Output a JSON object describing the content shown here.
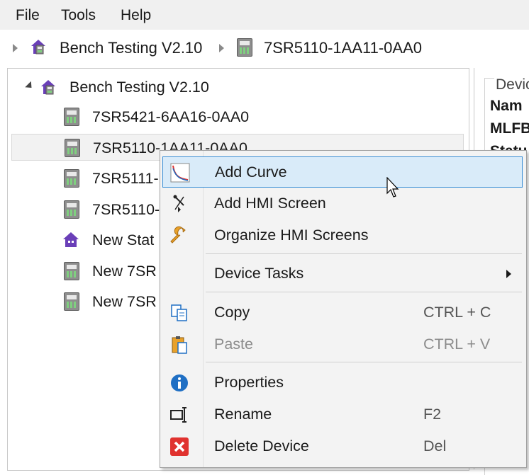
{
  "menubar": {
    "items": [
      "File",
      "Tools",
      "Help"
    ]
  },
  "breadcrumb": {
    "items": [
      "Bench Testing V2.10",
      "7SR5110-1AA11-0AA0"
    ]
  },
  "tree": {
    "root": "Bench Testing V2.10",
    "children": [
      "7SR5421-6AA16-0AA0",
      "7SR5110-1AA11-0AA0",
      "7SR5111-",
      "7SR5110-",
      "New Stat",
      "New 7SR",
      "New 7SR"
    ]
  },
  "right_panel": {
    "group_label": "Devic",
    "rows": [
      "Nam",
      "MLFB",
      "Statu"
    ]
  },
  "context_menu": {
    "items": [
      {
        "label": "Add Curve",
        "icon": "curve-icon"
      },
      {
        "label": "Add HMI Screen",
        "icon": "hmi-screen-icon"
      },
      {
        "label": "Organize HMI Screens",
        "icon": "wrench-icon"
      },
      {
        "label": "Device Tasks",
        "icon": ""
      },
      {
        "label": "Copy",
        "shortcut": "CTRL + C",
        "icon": "copy-icon"
      },
      {
        "label": "Paste",
        "shortcut": "CTRL + V",
        "icon": "paste-icon"
      },
      {
        "label": "Properties",
        "icon": "info-icon"
      },
      {
        "label": "Rename",
        "shortcut": "F2",
        "icon": "rename-icon"
      },
      {
        "label": "Delete Device",
        "shortcut": "Del",
        "icon": "delete-icon"
      }
    ]
  },
  "colors": {
    "highlight_bg": "#d9ebf9",
    "highlight_border": "#3a8fd6",
    "menubar_bg": "#f0f0f0",
    "delete_red": "#e0322f",
    "info_blue": "#1f6fc4",
    "wrench_orange": "#e8a12a"
  }
}
